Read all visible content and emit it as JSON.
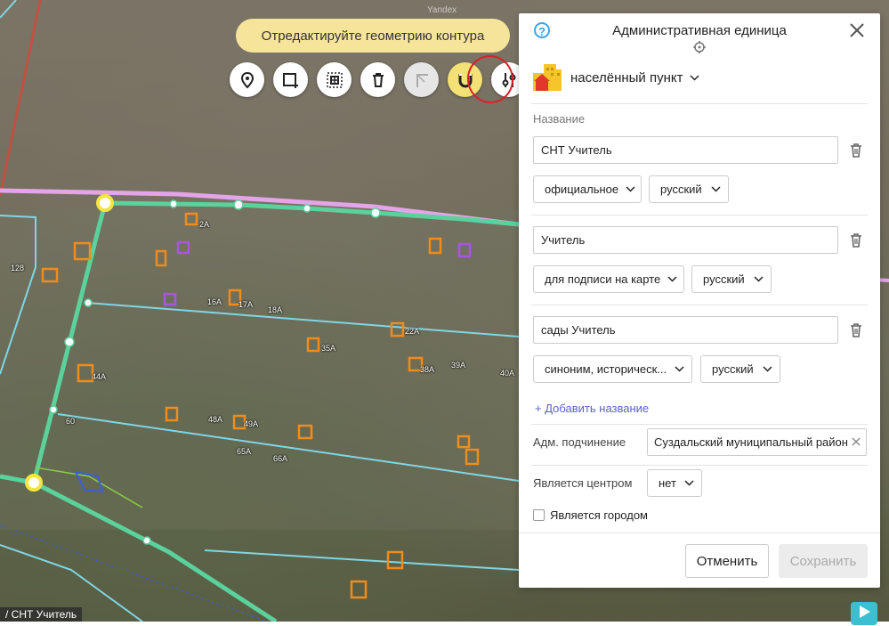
{
  "map": {
    "hint": "Отредактируйте геометрию контура",
    "watermark": "Yandex",
    "credit": "/ СНТ Учитель",
    "labels": [
      "2А",
      "128",
      "16А",
      "17А",
      "18А",
      "22А",
      "35А",
      "38А",
      "39А",
      "40А",
      "44А",
      "48А",
      "49А",
      "60",
      "65А",
      "66А"
    ]
  },
  "toolbar": {
    "buttons": [
      {
        "name": "place-pin-button",
        "icon": "pin-icon",
        "state": "normal"
      },
      {
        "name": "add-polygon-button",
        "icon": "add-polygon-icon",
        "state": "normal"
      },
      {
        "name": "add-hole-button",
        "icon": "add-hole-icon",
        "state": "normal"
      },
      {
        "name": "delete-geometry-button",
        "icon": "trash-icon",
        "state": "normal"
      },
      {
        "name": "cut-button",
        "icon": "corner-tool-icon",
        "state": "disabled"
      },
      {
        "name": "snapping-button",
        "icon": "magnet-icon",
        "state": "active"
      },
      {
        "name": "settings-button",
        "icon": "sliders-icon",
        "state": "normal"
      }
    ],
    "highlight_color": "#d8202a"
  },
  "panel": {
    "title": "Административная единица",
    "help": "?",
    "type": "населённый пункт",
    "names_label": "Название",
    "names": [
      {
        "value": "СНТ Учитель",
        "kind": "официальное",
        "lang": "русский"
      },
      {
        "value": "Учитель",
        "kind": "для подписи на карте",
        "lang": "русский"
      },
      {
        "value": "сады Учитель",
        "kind": "синоним, историческ...",
        "lang": "русский"
      }
    ],
    "add_name": "+ Добавить название",
    "subordination_label": "Адм. подчинение",
    "subordination_value": "Суздальский муниципальный район",
    "is_center_label": "Является центром",
    "is_center_value": "нет",
    "is_city_label": "Является городом",
    "cancel": "Отменить",
    "save": "Сохранить"
  },
  "colors": {
    "accent_green": "#4fd19a",
    "hint_bg": "#f6e49b",
    "link": "#5a63c4"
  }
}
